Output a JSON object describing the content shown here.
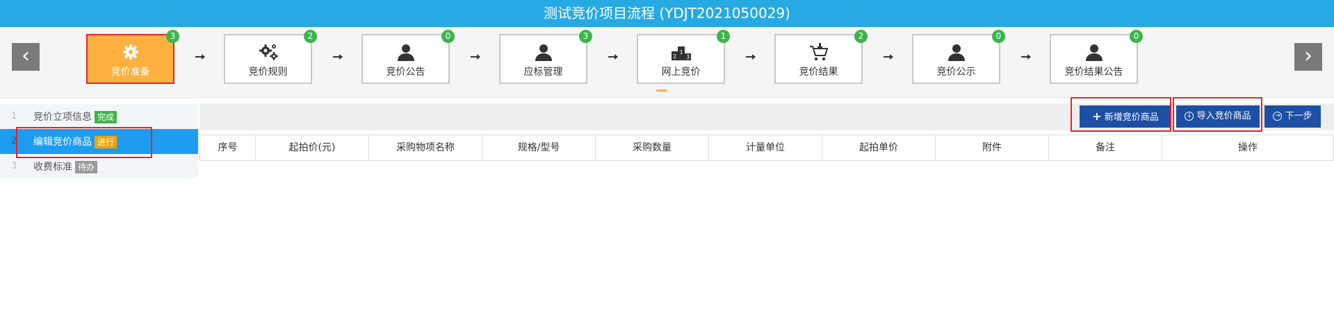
{
  "title": "测试竞价项目流程 (YDJT2021050029)",
  "nav": {
    "prev": "‹",
    "next": "›"
  },
  "steps": [
    {
      "label": "竞价准备",
      "count": "3",
      "icon": "gear-icon"
    },
    {
      "label": "竞价规则",
      "count": "2",
      "icon": "gears-icon"
    },
    {
      "label": "竞价公告",
      "count": "0",
      "icon": "user-icon"
    },
    {
      "label": "应标管理",
      "count": "3",
      "icon": "user-icon"
    },
    {
      "label": "网上竞价",
      "count": "1",
      "icon": "podium-icon"
    },
    {
      "label": "竞价结果",
      "count": "2",
      "icon": "cart-icon"
    },
    {
      "label": "竞价公示",
      "count": "0",
      "icon": "user-icon"
    },
    {
      "label": "竞价结果公告",
      "count": "0",
      "icon": "user-icon"
    }
  ],
  "sidebar": [
    {
      "num": "1",
      "label": "竞价立项信息",
      "tag": "完成",
      "tag_color": "#3cb54a"
    },
    {
      "num": "2",
      "label": "编辑竞价商品",
      "tag": "进行",
      "tag_color": "#f0a30a"
    },
    {
      "num": "3",
      "label": "收费标准",
      "tag": "待办",
      "tag_color": "#999999"
    }
  ],
  "toolbar": {
    "add": "新增竞价商品",
    "import": "导入竞价商品",
    "next": "下一步"
  },
  "table": {
    "columns": [
      "序号",
      "起拍价(元)",
      "采购物项名称",
      "规格/型号",
      "采购数量",
      "计量单位",
      "起拍单价",
      "附件",
      "备注",
      "操作"
    ]
  },
  "colors": {
    "header": "#27a9e3",
    "active_step": "#fbb040",
    "highlight": "#e8232b",
    "button": "#1d4fa5"
  }
}
